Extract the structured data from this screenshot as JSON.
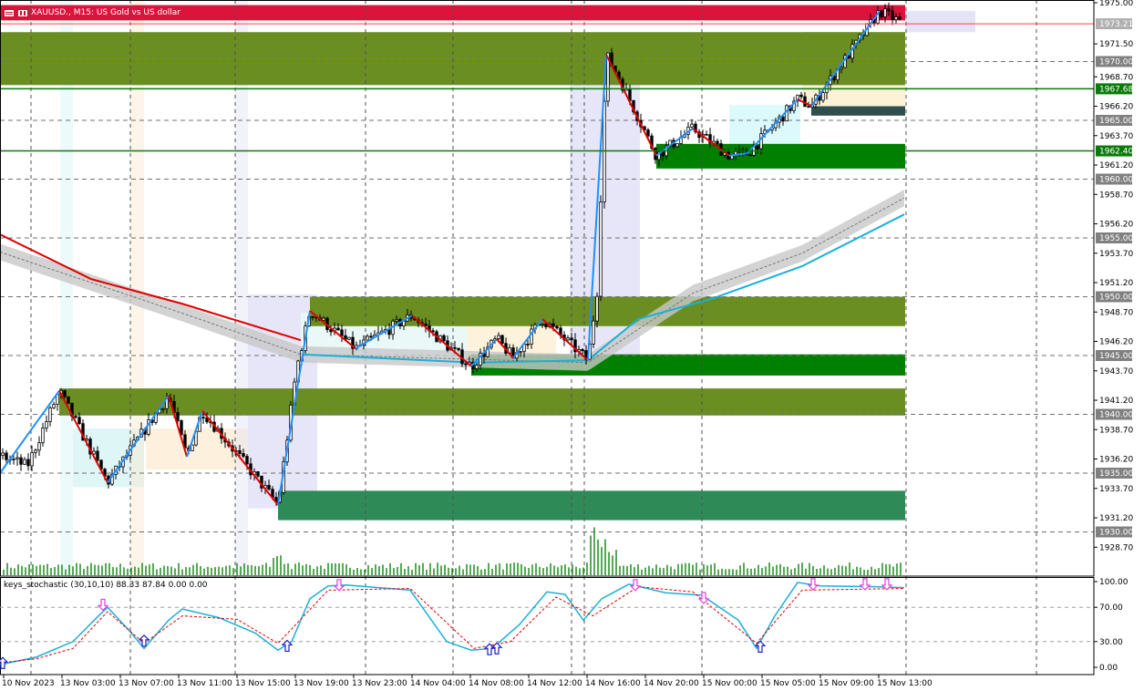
{
  "header": {
    "symbol_text": "XAUUSD., M15:  US Gold vs US dollar"
  },
  "indicator": {
    "title": "keys_stochastic (30,10,10) 88.33 87.84 0.00 0.00",
    "ticks": [
      {
        "label": "100.00",
        "value": 100
      },
      {
        "label": "70.00",
        "value": 70
      },
      {
        "label": "30.00",
        "value": 30
      },
      {
        "label": "0.00",
        "value": 0
      }
    ],
    "main_color": "#1ab0d8",
    "signal_color": "#e00000",
    "up_arrow_color": "#2020c0",
    "down_arrow_color": "#e040e0"
  },
  "price_axis": {
    "ticks": [
      "1975.00",
      "1971.50",
      "1968.70",
      "1966.20",
      "1963.70",
      "1961.20",
      "1958.70",
      "1956.20",
      "1953.70",
      "1951.20",
      "1948.70",
      "1946.20",
      "1943.70",
      "1941.20",
      "1938.70",
      "1936.20",
      "1933.70",
      "1931.20",
      "1928.70"
    ],
    "round_levels": [
      "1970.00",
      "1965.00",
      "1960.00",
      "1955.00",
      "1950.00",
      "1945.00",
      "1940.00",
      "1935.00",
      "1930.00"
    ],
    "current_price": "1973.21",
    "green_levels": [
      "1967.68",
      "1962.40"
    ]
  },
  "time_axis": {
    "labels": [
      "10 Nov 2023",
      "13 Nov 03:00",
      "13 Nov 07:00",
      "13 Nov 11:00",
      "13 Nov 15:00",
      "13 Nov 19:00",
      "13 Nov 23:00",
      "14 Nov 04:00",
      "14 Nov 08:00",
      "14 Nov 12:00",
      "14 Nov 16:00",
      "14 Nov 20:00",
      "15 Nov 00:00",
      "15 Nov 05:00",
      "15 Nov 09:00",
      "15 Nov 13:00"
    ]
  },
  "colors": {
    "supply_zone": "#6b8e23",
    "demand_zone": "#008000",
    "deep_demand": "#2e8b57",
    "top_band": "#dc143c",
    "zigzag_up": "#1e90ff",
    "zigzag_down": "#e00000",
    "ma_red": "#e00000",
    "ma_blue": "#1ab0d8",
    "candle": "#000000",
    "volume": "#1a8c1a"
  },
  "chart_data": {
    "type": "candlestick",
    "symbol": "XAUUSD.",
    "timeframe": "M15",
    "ylim": [
      1926.5,
      1975.0
    ],
    "price_path": [
      [
        0,
        1936.5
      ],
      [
        30,
        1935.6
      ],
      [
        65,
        1942.0
      ],
      [
        118,
        1934.2
      ],
      [
        185,
        1941.6
      ],
      [
        205,
        1936.4
      ],
      [
        222,
        1940.3
      ],
      [
        305,
        1932.3
      ],
      [
        325,
        1943.8
      ],
      [
        340,
        1948.8
      ],
      [
        390,
        1945.6
      ],
      [
        452,
        1948.4
      ],
      [
        517,
        1944.1
      ],
      [
        545,
        1946.4
      ],
      [
        563,
        1944.8
      ],
      [
        595,
        1948.1
      ],
      [
        645,
        1944.6
      ],
      [
        655,
        1950.5
      ],
      [
        665,
        1970.6
      ],
      [
        682,
        1968.2
      ],
      [
        720,
        1962.0
      ],
      [
        760,
        1964.3
      ],
      [
        800,
        1962.0
      ],
      [
        820,
        1962.2
      ],
      [
        840,
        1963.8
      ],
      [
        875,
        1966.8
      ],
      [
        890,
        1966.2
      ],
      [
        930,
        1970.5
      ],
      [
        965,
        1974.3
      ],
      [
        992,
        1973.2
      ]
    ],
    "zigzag_points": [
      [
        0,
        1935.0
      ],
      [
        65,
        1942.0
      ],
      [
        118,
        1934.2
      ],
      [
        185,
        1941.6
      ],
      [
        205,
        1936.4
      ],
      [
        222,
        1940.3
      ],
      [
        305,
        1932.3
      ],
      [
        340,
        1948.8
      ],
      [
        390,
        1945.6
      ],
      [
        452,
        1948.4
      ],
      [
        517,
        1944.1
      ],
      [
        545,
        1946.4
      ],
      [
        563,
        1944.8
      ],
      [
        595,
        1948.1
      ],
      [
        645,
        1944.6
      ],
      [
        665,
        1970.6
      ],
      [
        720,
        1962.0
      ],
      [
        760,
        1964.3
      ],
      [
        800,
        1962.0
      ],
      [
        820,
        1962.2
      ],
      [
        875,
        1966.8
      ],
      [
        890,
        1966.2
      ],
      [
        965,
        1974.3
      ]
    ],
    "ma_red": [
      [
        0,
        1955.3
      ],
      [
        100,
        1951.5
      ],
      [
        200,
        1949.4
      ],
      [
        330,
        1946.3
      ]
    ],
    "ma_blue": [
      [
        330,
        1945.1
      ],
      [
        520,
        1944.4
      ],
      [
        645,
        1944.6
      ],
      [
        700,
        1948.1
      ],
      [
        780,
        1949.8
      ],
      [
        880,
        1952.6
      ],
      [
        992,
        1957.0
      ]
    ],
    "ma_gray_band": [
      [
        0,
        1953.8
      ],
      [
        200,
        1948.6
      ],
      [
        330,
        1945.1
      ],
      [
        645,
        1944.4
      ],
      [
        760,
        1950.3
      ],
      [
        880,
        1953.7
      ],
      [
        992,
        1958.4
      ]
    ],
    "zones": [
      {
        "kind": "band",
        "x": [
          0,
          993
        ],
        "price": [
          1973.5,
          1974.8
        ]
      },
      {
        "kind": "supply",
        "x": [
          0,
          993
        ],
        "price": [
          1968.0,
          1972.5
        ]
      },
      {
        "kind": "supply",
        "x": [
          880,
          993
        ],
        "price": [
          1968.0,
          1972.5
        ]
      },
      {
        "kind": "demand",
        "x": [
          720,
          993
        ],
        "price": [
          1960.9,
          1963.0
        ]
      },
      {
        "kind": "supply",
        "x": [
          340,
          993
        ],
        "price": [
          1947.5,
          1950.0
        ]
      },
      {
        "kind": "demand",
        "x": [
          517,
          993
        ],
        "price": [
          1943.3,
          1945.1
        ]
      },
      {
        "kind": "supply",
        "x": [
          65,
          993
        ],
        "price": [
          1939.9,
          1942.2
        ]
      },
      {
        "kind": "deep_demand",
        "x": [
          305,
          993
        ],
        "price": [
          1931.0,
          1933.5
        ]
      }
    ],
    "stochastic_main": [
      [
        0,
        3
      ],
      [
        40,
        12
      ],
      [
        80,
        30
      ],
      [
        110,
        62
      ],
      [
        118,
        70
      ],
      [
        140,
        45
      ],
      [
        158,
        22
      ],
      [
        185,
        55
      ],
      [
        200,
        68
      ],
      [
        240,
        58
      ],
      [
        280,
        40
      ],
      [
        305,
        20
      ],
      [
        320,
        30
      ],
      [
        340,
        80
      ],
      [
        360,
        95
      ],
      [
        380,
        96
      ],
      [
        450,
        90
      ],
      [
        490,
        30
      ],
      [
        517,
        20
      ],
      [
        540,
        22
      ],
      [
        570,
        50
      ],
      [
        600,
        88
      ],
      [
        620,
        85
      ],
      [
        640,
        55
      ],
      [
        660,
        80
      ],
      [
        690,
        97
      ],
      [
        730,
        87
      ],
      [
        770,
        84
      ],
      [
        810,
        55
      ],
      [
        830,
        22
      ],
      [
        850,
        60
      ],
      [
        875,
        99
      ],
      [
        900,
        95
      ],
      [
        960,
        94
      ],
      [
        992,
        93
      ]
    ],
    "stochastic_signal": [
      [
        0,
        5
      ],
      [
        40,
        10
      ],
      [
        80,
        22
      ],
      [
        118,
        65
      ],
      [
        158,
        28
      ],
      [
        200,
        60
      ],
      [
        260,
        56
      ],
      [
        305,
        28
      ],
      [
        360,
        90
      ],
      [
        450,
        92
      ],
      [
        520,
        22
      ],
      [
        560,
        30
      ],
      [
        610,
        82
      ],
      [
        650,
        60
      ],
      [
        700,
        94
      ],
      [
        760,
        88
      ],
      [
        830,
        28
      ],
      [
        880,
        90
      ],
      [
        992,
        92
      ]
    ],
    "stochastic_up_arrows": [
      [
        3,
        4
      ],
      [
        158,
        30
      ],
      [
        315,
        24
      ],
      [
        537,
        20
      ],
      [
        545,
        21
      ],
      [
        834,
        23
      ]
    ],
    "stochastic_down_arrows": [
      [
        113,
        74
      ],
      [
        372,
        97
      ],
      [
        697,
        97
      ],
      [
        772,
        82
      ],
      [
        892,
        98
      ],
      [
        949,
        98
      ],
      [
        973,
        98
      ]
    ]
  }
}
